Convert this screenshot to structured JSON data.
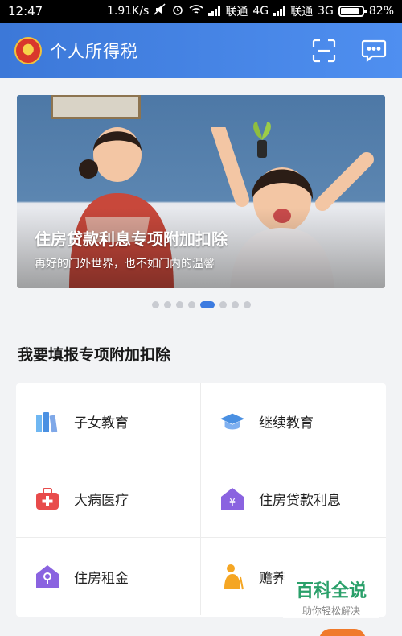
{
  "status_bar": {
    "time": "12:47",
    "speed": "1.91K/s",
    "carrier1": "联通",
    "net1": "4G",
    "carrier2": "联通",
    "net2": "3G",
    "battery": "82%"
  },
  "header": {
    "title": "个人所得税",
    "icons": [
      "national-emblem-icon",
      "scan-icon",
      "message-icon"
    ]
  },
  "banner": {
    "title": "住房贷款利息专项附加扣除",
    "subtitle": "再好的门外世界，也不如门内的温馨",
    "carousel": {
      "count": 8,
      "active_index": 4
    }
  },
  "section": {
    "title": "我要填报专项附加扣除"
  },
  "deductions": [
    {
      "label": "子女教育",
      "icon": "books-icon",
      "color": "#4a90e2"
    },
    {
      "label": "继续教育",
      "icon": "graduation-cap-icon",
      "color": "#4a90e2"
    },
    {
      "label": "大病医疗",
      "icon": "medical-kit-icon",
      "color": "#e84b4b"
    },
    {
      "label": "住房贷款利息",
      "icon": "house-yuan-icon",
      "color": "#8a63e0"
    },
    {
      "label": "住房租金",
      "icon": "house-key-icon",
      "color": "#8a63e0"
    },
    {
      "label": "赡养",
      "icon": "elderly-icon",
      "color": "#f5a623"
    }
  ],
  "watermark": {
    "main": "百科全说",
    "sub": "助你轻松解决"
  }
}
